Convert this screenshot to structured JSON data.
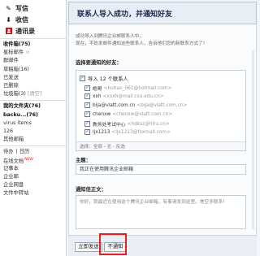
{
  "sidebar": {
    "top_items": [
      {
        "label": "写信",
        "icon": "pencil-icon"
      },
      {
        "label": "收信",
        "icon": "inbox-icon"
      },
      {
        "label": "通讯录",
        "icon": "contacts-icon"
      }
    ],
    "folders": [
      {
        "label": "收件箱(75)",
        "bold": true
      },
      {
        "label": "星标邮件",
        "suffix": "☆"
      },
      {
        "label": "群邮件"
      },
      {
        "label": "草稿箱(16)"
      },
      {
        "label": "已发送"
      },
      {
        "label": "已删除"
      },
      {
        "label": "垃圾箱(3)",
        "aux": "[清空]"
      }
    ],
    "my_folders": [
      {
        "label": "我的文件夹(76)",
        "bold": true
      },
      {
        "label": "backu...(76)",
        "bold": true
      },
      {
        "label": "virus items"
      },
      {
        "label": "126"
      },
      {
        "label": "其他邮箱"
      }
    ],
    "tools": {
      "pair": [
        "待办",
        "日历"
      ],
      "items": [
        {
          "label": "在线文档",
          "badge": "NEW"
        },
        {
          "label": "记事本"
        },
        {
          "label": "企业邮"
        },
        {
          "label": "企业网盘"
        },
        {
          "label": "文件中转站"
        }
      ]
    }
  },
  "main": {
    "title": "联系人导入成功，并通知好友",
    "hint_line1": "成功导入到腾讯企业邮联系人中。",
    "hint_line2": "现在，不妨发邮件通知这些联系人，告诉他们您的新联系方式了！",
    "select_label": "选择要通知的好友：",
    "select_all_label": "导入 12 个联系人",
    "friends": [
      {
        "name": "皓哥",
        "email": "<huhao_061@hotmail.com>",
        "checked": true
      },
      {
        "name": "xxh",
        "email": "<xxxh@mail.csu.edu.cn>",
        "checked": true
      },
      {
        "name": "bija@vlatt.com.cn",
        "email": "<bija@vlatt.com.cn>",
        "checked": true
      },
      {
        "name": "chenxw",
        "email": "<chenxw@vlatt.com.cn>",
        "checked": true
      },
      {
        "name": "教务处考试中心",
        "email": "<hdksz@hhu.cn>",
        "checked": true
      },
      {
        "name": "ljx1213",
        "email": "<ljx1213@foxmail.com>",
        "checked": true
      }
    ],
    "select_options": "选择：全部 - 无 - 反选",
    "subject_label": "主题：",
    "subject_value": "我正在使用腾讯企业邮箱",
    "body_label": "通知信正文：",
    "body_value": "你好，我最近在使用这个腾讯企业邮箱，有事请发到这里。常空多联系！",
    "buttons": {
      "send": "立即发送",
      "skip": "不通知"
    }
  }
}
